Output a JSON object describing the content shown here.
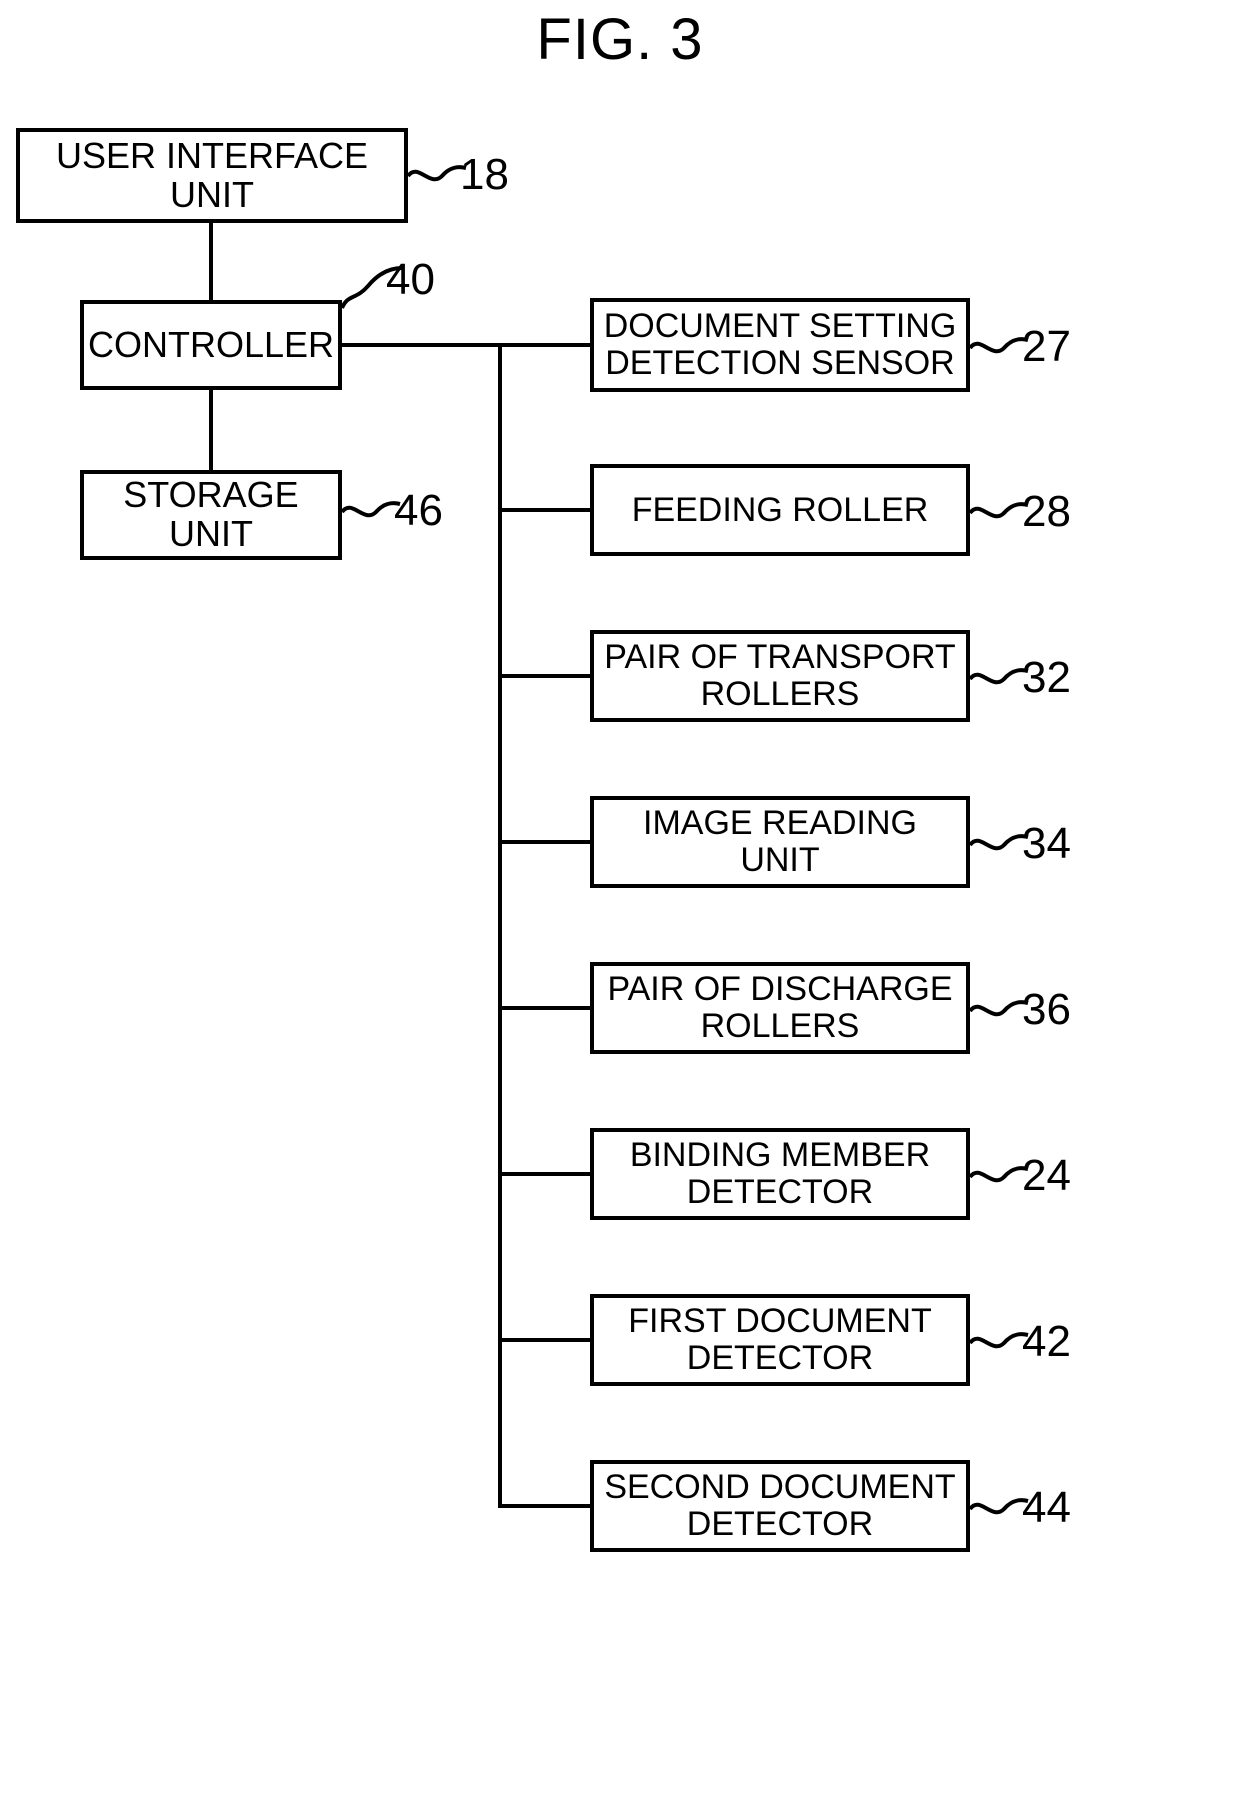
{
  "figure": {
    "title": "FIG. 3",
    "type": "patent-block-diagram"
  },
  "left_column": {
    "nodes": [
      {
        "id": "user-interface-unit",
        "label": "USER INTERFACE UNIT",
        "ref": "18"
      },
      {
        "id": "controller",
        "label": "CONTROLLER",
        "ref": "40"
      },
      {
        "id": "storage-unit",
        "label": "STORAGE UNIT",
        "ref": "46"
      }
    ]
  },
  "right_column": {
    "nodes": [
      {
        "id": "document-setting-detection-sensor",
        "label": "DOCUMENT SETTING\nDETECTION SENSOR",
        "ref": "27"
      },
      {
        "id": "feeding-roller",
        "label": "FEEDING ROLLER",
        "ref": "28"
      },
      {
        "id": "pair-of-transport-rollers",
        "label": "PAIR OF TRANSPORT\nROLLERS",
        "ref": "32"
      },
      {
        "id": "image-reading-unit",
        "label": "IMAGE READING UNIT",
        "ref": "34"
      },
      {
        "id": "pair-of-discharge-rollers",
        "label": "PAIR OF DISCHARGE\nROLLERS",
        "ref": "36"
      },
      {
        "id": "binding-member-detector",
        "label": "BINDING MEMBER\nDETECTOR",
        "ref": "24"
      },
      {
        "id": "first-document-detector",
        "label": "FIRST DOCUMENT\nDETECTOR",
        "ref": "42"
      },
      {
        "id": "second-document-detector",
        "label": "SECOND DOCUMENT\nDETECTOR",
        "ref": "44"
      }
    ]
  },
  "colors": {
    "line": "#000000",
    "background": "#ffffff",
    "text": "#000000"
  }
}
